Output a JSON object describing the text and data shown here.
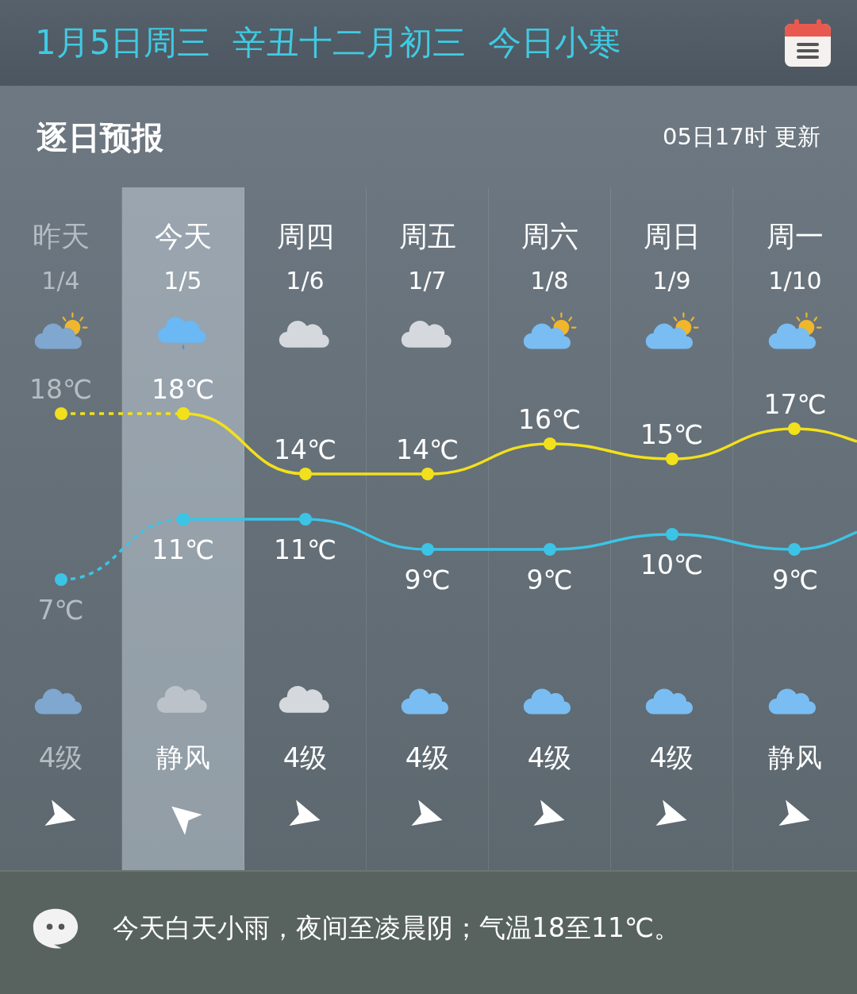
{
  "top_bar": {
    "solar_date": "1月5日周三",
    "lunar_date": "辛丑十二月初三",
    "solar_term": "今日小寒"
  },
  "forecast": {
    "title": "逐日预报",
    "updated": "05日17时 更新",
    "days": [
      {
        "name": "昨天",
        "day_icon": {
          "kind": "partly_sunny"
        },
        "night_icon": {
          "kind": "partly_cloudy_night"
        },
        "wind": "4级",
        "wind_arrow": {
          "kind": "east"
        },
        "selected": false,
        "past": true
      },
      {
        "name": "今天",
        "day_icon": {
          "kind": "rain"
        },
        "night_icon": {
          "kind": "cloudy_dim"
        },
        "wind": "静风",
        "wind_arrow": {
          "kind": "northwest"
        },
        "selected": true,
        "past": false
      },
      {
        "name": "周四",
        "day_icon": {
          "kind": "cloudy"
        },
        "night_icon": {
          "kind": "cloudy"
        },
        "wind": "4级",
        "wind_arrow": {
          "kind": "east"
        },
        "selected": false,
        "past": false
      },
      {
        "name": "周五",
        "day_icon": {
          "kind": "cloudy"
        },
        "night_icon": {
          "kind": "partly_cloudy_night"
        },
        "wind": "4级",
        "wind_arrow": {
          "kind": "east"
        },
        "selected": false,
        "past": false
      },
      {
        "name": "周六",
        "day_icon": {
          "kind": "partly_sunny"
        },
        "night_icon": {
          "kind": "partly_cloudy_night"
        },
        "wind": "4级",
        "wind_arrow": {
          "kind": "east"
        },
        "selected": false,
        "past": false
      },
      {
        "name": "周日",
        "day_icon": {
          "kind": "partly_sunny"
        },
        "night_icon": {
          "kind": "partly_cloudy_night"
        },
        "wind": "4级",
        "wind_arrow": {
          "kind": "east"
        },
        "selected": false,
        "past": false
      },
      {
        "name": "周一",
        "day_icon": {
          "kind": "partly_sunny"
        },
        "night_icon": {
          "kind": "partly_cloudy_night"
        },
        "wind": "静风",
        "wind_arrow": {
          "kind": "east"
        },
        "selected": false,
        "past": false
      }
    ],
    "chart_data": {
      "type": "line",
      "categories": [
        "1/4",
        "1/5",
        "1/6",
        "1/7",
        "1/8",
        "1/9",
        "1/10"
      ],
      "series": [
        {
          "color": "#f2e01c",
          "line_style": "dashed",
          "marker": "circle",
          "values": [
            18,
            18,
            null,
            null,
            null,
            null,
            null
          ],
          "value_labels": [
            "18℃",
            null,
            null,
            null,
            null,
            null,
            null
          ]
        },
        {
          "color": "#f2e01c",
          "line_style": "solid",
          "marker": "circle",
          "values": [
            null,
            18,
            14,
            14,
            16,
            15,
            17
          ],
          "value_labels": [
            null,
            "18℃",
            "14℃",
            "14℃",
            "16℃",
            "15℃",
            "17℃"
          ]
        },
        {
          "color": "#3cc4e6",
          "line_style": "dashed",
          "marker": "circle",
          "values": [
            7,
            11,
            null,
            null,
            null,
            null,
            null
          ],
          "value_labels": [
            "7℃",
            null,
            null,
            null,
            null,
            null,
            null
          ]
        },
        {
          "color": "#3cc4e6",
          "line_style": "solid",
          "marker": "circle",
          "values": [
            null,
            11,
            11,
            9,
            9,
            10,
            9
          ],
          "value_labels": [
            null,
            "11℃",
            "11℃",
            "9℃",
            "9℃",
            "10℃",
            "9℃"
          ]
        }
      ]
    }
  },
  "summary": "今天白天小雨，夜间至凌晨阴；气温18至11℃。"
}
